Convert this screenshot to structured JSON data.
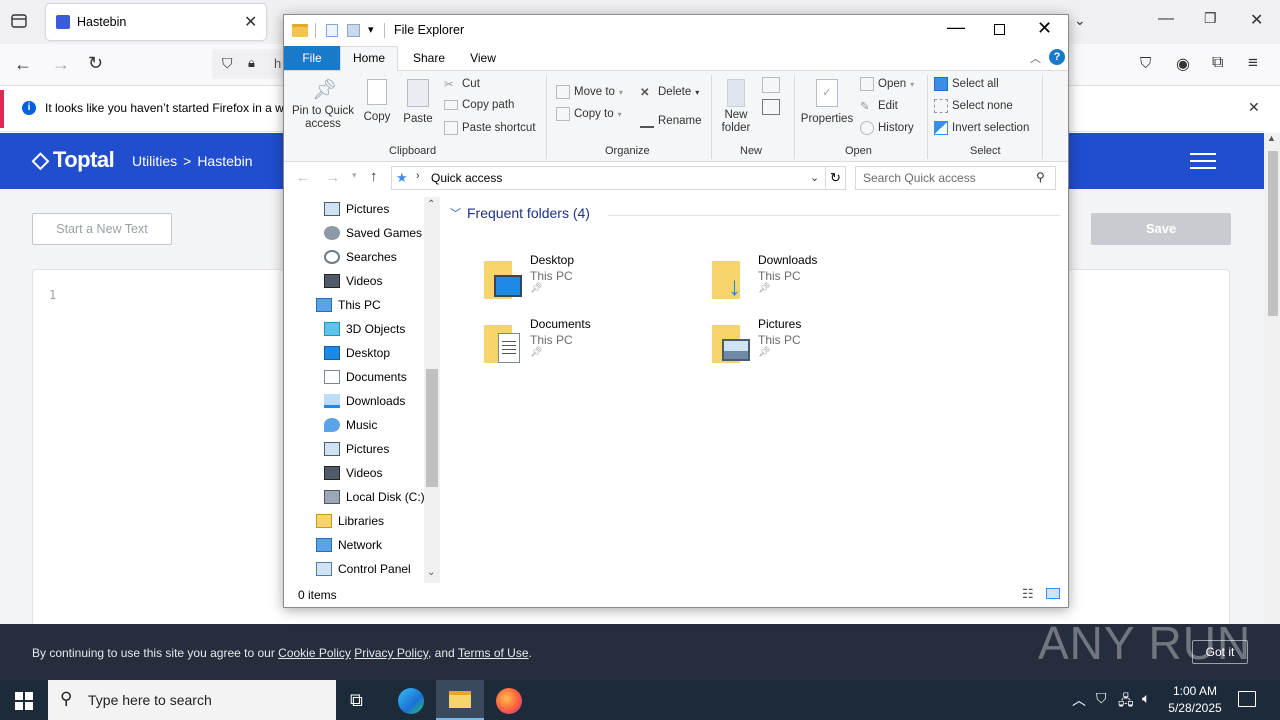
{
  "firefox": {
    "tab_title": "Hastebin",
    "url_partial": "h",
    "notice_text": "It looks like you haven’t started Firefox in a wh"
  },
  "site": {
    "logo": "Toptal",
    "breadcrumb_1": "Utilities",
    "breadcrumb_sep": ">",
    "breadcrumb_2": "Hastebin",
    "new_text_button": "Start a New Text",
    "save_button": "Save",
    "line_number": "1",
    "cookie_prefix": "By continuing to use this site you agree to our ",
    "cookie_link_1": "Cookie Policy",
    "cookie_link_2": "Privacy Policy",
    "cookie_and": ", and ",
    "cookie_link_3": "Terms of Use",
    "cookie_end": ".",
    "got_it": "Got it",
    "watermark": "ANY RUN"
  },
  "explorer": {
    "title": "File Explorer",
    "tabs": [
      "File",
      "Home",
      "Share",
      "View"
    ],
    "active_tab": "Home",
    "ribbon": {
      "clipboard": {
        "label": "Clipboard",
        "pin": "Pin to Quick access",
        "copy": "Copy",
        "paste": "Paste",
        "cut": "Cut",
        "copy_path": "Copy path",
        "paste_shortcut": "Paste shortcut"
      },
      "organize": {
        "label": "Organize",
        "move_to": "Move to",
        "copy_to": "Copy to",
        "delete": "Delete",
        "rename": "Rename"
      },
      "new": {
        "label": "New",
        "new_folder": "New folder"
      },
      "open": {
        "label": "Open",
        "properties": "Properties",
        "open": "Open",
        "edit": "Edit",
        "history": "History"
      },
      "select": {
        "label": "Select",
        "select_all": "Select all",
        "select_none": "Select none",
        "invert": "Invert selection"
      }
    },
    "address": "Quick access",
    "search_placeholder": "Search Quick access",
    "nav_items": [
      {
        "label": "Pictures",
        "icon": "pictures-icon",
        "indent": 1
      },
      {
        "label": "Saved Games",
        "icon": "saved-games-icon",
        "indent": 1
      },
      {
        "label": "Searches",
        "icon": "searches-icon",
        "indent": 1
      },
      {
        "label": "Videos",
        "icon": "videos-icon",
        "indent": 1
      },
      {
        "label": "This PC",
        "icon": "this-pc-icon",
        "indent": 0
      },
      {
        "label": "3D Objects",
        "icon": "3d-objects-icon",
        "indent": 1
      },
      {
        "label": "Desktop",
        "icon": "desktop-icon",
        "indent": 1
      },
      {
        "label": "Documents",
        "icon": "documents-icon",
        "indent": 1
      },
      {
        "label": "Downloads",
        "icon": "downloads-icon",
        "indent": 1
      },
      {
        "label": "Music",
        "icon": "music-icon",
        "indent": 1
      },
      {
        "label": "Pictures",
        "icon": "pictures-icon",
        "indent": 1
      },
      {
        "label": "Videos",
        "icon": "videos-icon",
        "indent": 1
      },
      {
        "label": "Local Disk (C:)",
        "icon": "local-disk-icon",
        "indent": 1
      },
      {
        "label": "Libraries",
        "icon": "libraries-icon",
        "indent": 0
      },
      {
        "label": "Network",
        "icon": "network-icon",
        "indent": 0
      },
      {
        "label": "Control Panel",
        "icon": "control-panel-icon",
        "indent": 0
      }
    ],
    "section_header": "Frequent folders (4)",
    "folders": [
      {
        "name": "Desktop",
        "location": "This PC"
      },
      {
        "name": "Downloads",
        "location": "This PC"
      },
      {
        "name": "Documents",
        "location": "This PC"
      },
      {
        "name": "Pictures",
        "location": "This PC"
      }
    ],
    "status": "0 items"
  },
  "taskbar": {
    "search_placeholder": "Type here to search",
    "time": "1:00 AM",
    "date": "5/28/2025"
  },
  "colors": {
    "toptal_blue": "#204ecf",
    "file_tab_blue": "#1979ca",
    "cookie_bg": "#262d3d",
    "taskbar": "#1c2a3a"
  }
}
